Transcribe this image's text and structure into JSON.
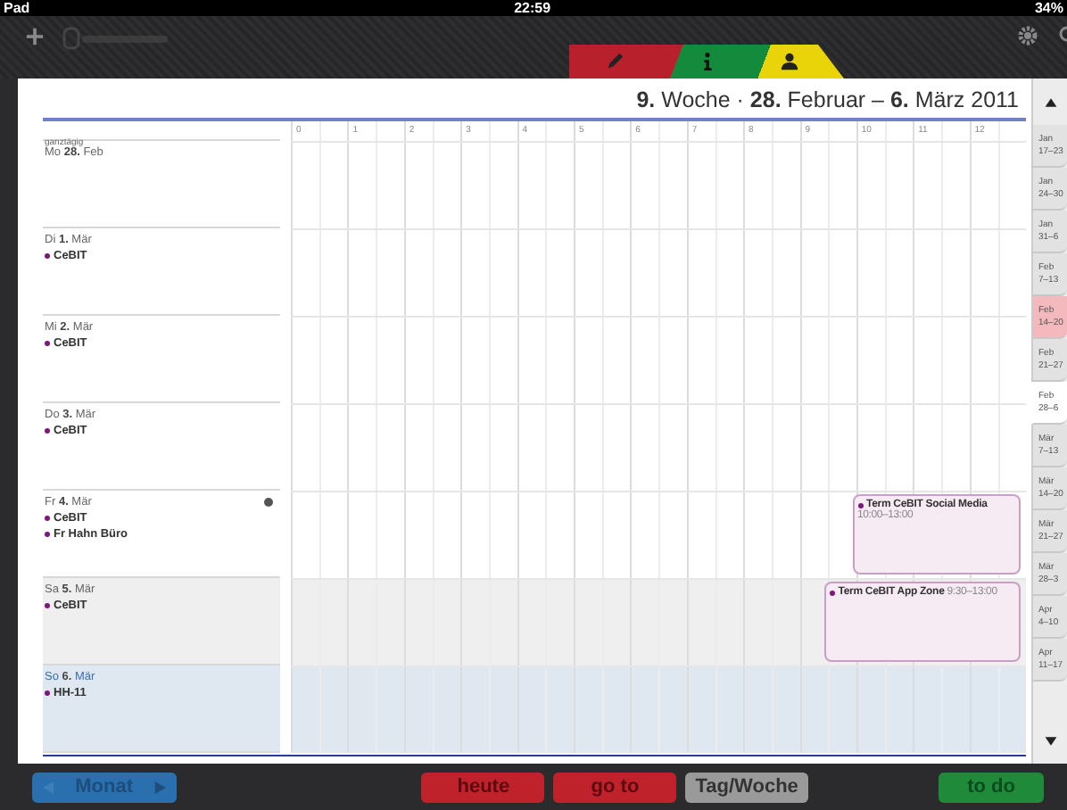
{
  "status_bar": {
    "carrier": "Pad",
    "time": "22:59",
    "battery": "34%"
  },
  "toolbar": {
    "tabs": [
      {
        "kind": "edit",
        "color": "#b8202c"
      },
      {
        "kind": "info",
        "color": "#138a3c"
      },
      {
        "kind": "person",
        "color": "#e9d40a"
      }
    ]
  },
  "header": {
    "title": "**9.** Woche · **28.** Februar – **6.** März 2011"
  },
  "grid": {
    "allday_label": "ganztägig",
    "hours": [
      "0",
      "1",
      "2",
      "3",
      "4",
      "5",
      "6",
      "7",
      "8",
      "9",
      "10",
      "11",
      "12"
    ]
  },
  "days": [
    {
      "label": "Mo **28.** Feb",
      "kind": "weekday",
      "flagged": false
    },
    {
      "label": "Di **1.** Mär",
      "kind": "weekday",
      "flagged": false,
      "entries": [
        "CeBIT"
      ]
    },
    {
      "label": "Mi **2.** Mär",
      "kind": "weekday",
      "flagged": false,
      "entries": [
        "CeBIT"
      ]
    },
    {
      "label": "Do **3.** Mär",
      "kind": "weekday",
      "flagged": false,
      "entries": [
        "CeBIT"
      ]
    },
    {
      "label": "Fr **4.** Mär",
      "kind": "weekday",
      "flagged": true,
      "entries": [
        "CeBIT",
        "Fr Hahn Büro"
      ],
      "events": [
        {
          "title": "Term CeBIT Social Media",
          "time": "10:00–13:00",
          "time_inline": false
        }
      ]
    },
    {
      "label": "Sa **5.** Mär",
      "kind": "saturday",
      "flagged": false,
      "entries": [
        "CeBIT"
      ],
      "events": [
        {
          "title": "Term CeBIT App Zone",
          "time": "9:30–13:00",
          "time_inline": true
        }
      ]
    },
    {
      "label": "So **6.** Mär",
      "kind": "sunday",
      "flagged": false,
      "entries": [
        "HH-11"
      ]
    }
  ],
  "weeks": [
    {
      "month": "Jan",
      "range": "17–23",
      "selected": false,
      "highlighted": false
    },
    {
      "month": "Jan",
      "range": "24–30",
      "selected": false,
      "highlighted": false
    },
    {
      "month": "Jan",
      "range": "31–6",
      "selected": false,
      "highlighted": false
    },
    {
      "month": "Feb",
      "range": "7–13",
      "selected": false,
      "highlighted": false
    },
    {
      "month": "Feb",
      "range": "14–20",
      "selected": false,
      "highlighted": true
    },
    {
      "month": "Feb",
      "range": "21–27",
      "selected": false,
      "highlighted": false
    },
    {
      "month": "Feb",
      "range": "28–6",
      "selected": true,
      "highlighted": false
    },
    {
      "month": "Mär",
      "range": "7–13",
      "selected": false,
      "highlighted": false
    },
    {
      "month": "Mär",
      "range": "14–20",
      "selected": false,
      "highlighted": false
    },
    {
      "month": "Mär",
      "range": "21–27",
      "selected": false,
      "highlighted": false
    },
    {
      "month": "Mär",
      "range": "28–3",
      "selected": false,
      "highlighted": false
    },
    {
      "month": "Apr",
      "range": "4–10",
      "selected": false,
      "highlighted": false
    },
    {
      "month": "Apr",
      "range": "11–17",
      "selected": false,
      "highlighted": false
    }
  ],
  "bottom_bar": {
    "month_button": "Monat",
    "buttons": [
      {
        "label": "heute",
        "color": "#c0222c",
        "selected": false
      },
      {
        "label": "go to",
        "color": "#c0222c",
        "selected": false
      },
      {
        "label": "Tag/Woche",
        "color": "#9a9a9a",
        "selected": true
      },
      {
        "label": "to do",
        "color": "#1f8a3a",
        "selected": false
      }
    ]
  }
}
